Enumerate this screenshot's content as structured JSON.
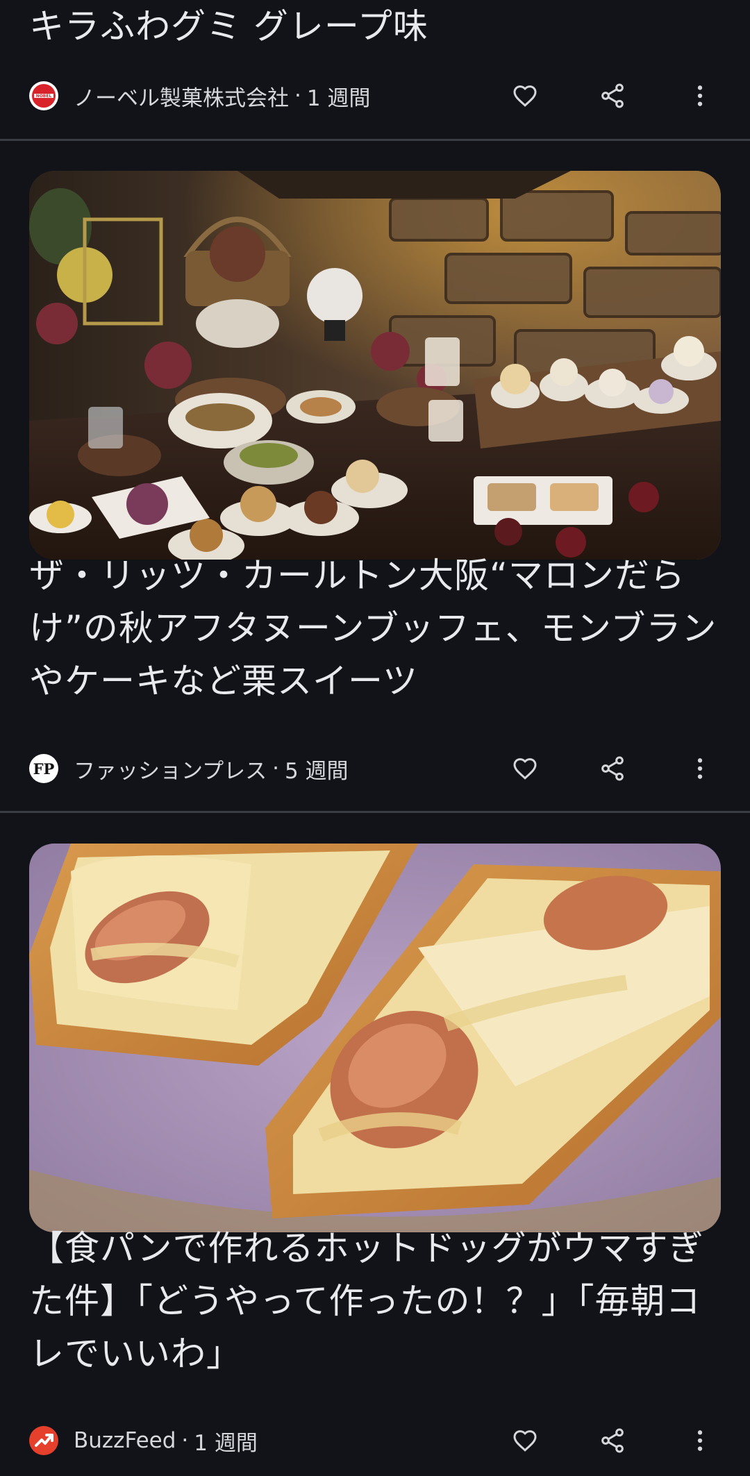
{
  "articles": [
    {
      "title": "キラふわグミ グレープ味",
      "source": "ノーベル製菓株式会社",
      "age": "1 週間",
      "logo_text": "NOBEL",
      "logo_icon": "nobel-logo",
      "actions": [
        "heart-icon",
        "share-icon",
        "more-vert-icon"
      ]
    },
    {
      "title": "ザ・リッツ・カールトン大阪“マロンだらけ”の秋アフタヌーンブッフェ、モンブランやケーキなど栗スイーツ",
      "source": "ファッションプレス",
      "age": "5 週間",
      "logo_text": "FP",
      "image": "autumn-dessert-buffet-photo",
      "actions": [
        "heart-icon",
        "share-icon",
        "more-vert-icon"
      ]
    },
    {
      "title": "【食パンで作れるホットドッグがウマすぎた件】「どうやって作ったの！？」「毎朝コレでいいわ」",
      "source": "BuzzFeed",
      "age": "1 週間",
      "logo_icon": "buzzfeed-trending-logo",
      "image": "bread-hotdog-photo",
      "actions": [
        "heart-icon",
        "share-icon",
        "more-vert-icon"
      ]
    }
  ],
  "colors": {
    "background": "#111318",
    "divider": "#3a3d44",
    "text": "#e8e9ec",
    "meta": "#d6d7db",
    "nobel_red": "#d8232a",
    "buzzfeed_red": "#e4402b"
  }
}
